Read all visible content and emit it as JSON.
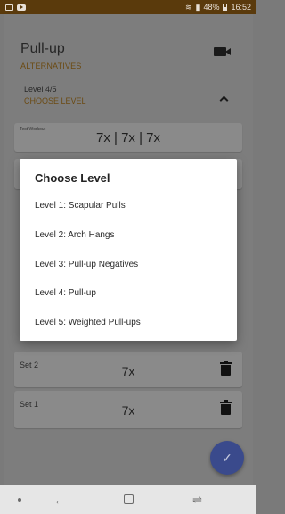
{
  "status_bar": {
    "battery": "48%",
    "time": "16:52"
  },
  "exercise": {
    "title": "Pull-up",
    "alternatives_label": "ALTERNATIVES",
    "level_text": "Level 4/5",
    "choose_level_label": "CHOOSE LEVEL"
  },
  "test_workout": {
    "label": "Test Workout",
    "reps": "7x | 7x | 7x"
  },
  "sets": [
    {
      "label": "Set 2",
      "reps": "7x"
    },
    {
      "label": "Set 1",
      "reps": "7x"
    }
  ],
  "dialog": {
    "title": "Choose Level",
    "options": [
      "Level 1: Scapular Pulls",
      "Level 2: Arch Hangs",
      "Level 3: Pull-up Negatives",
      "Level 4: Pull-up",
      "Level 5: Weighted Pull-ups"
    ]
  },
  "icons": {
    "camera": "video-camera-icon",
    "chevron": "chevron-up-icon",
    "trash": "trash-icon",
    "fab": "check-icon"
  },
  "colors": {
    "accent_brown": "#6b4a12",
    "fab_blue": "#3a4a8c"
  }
}
